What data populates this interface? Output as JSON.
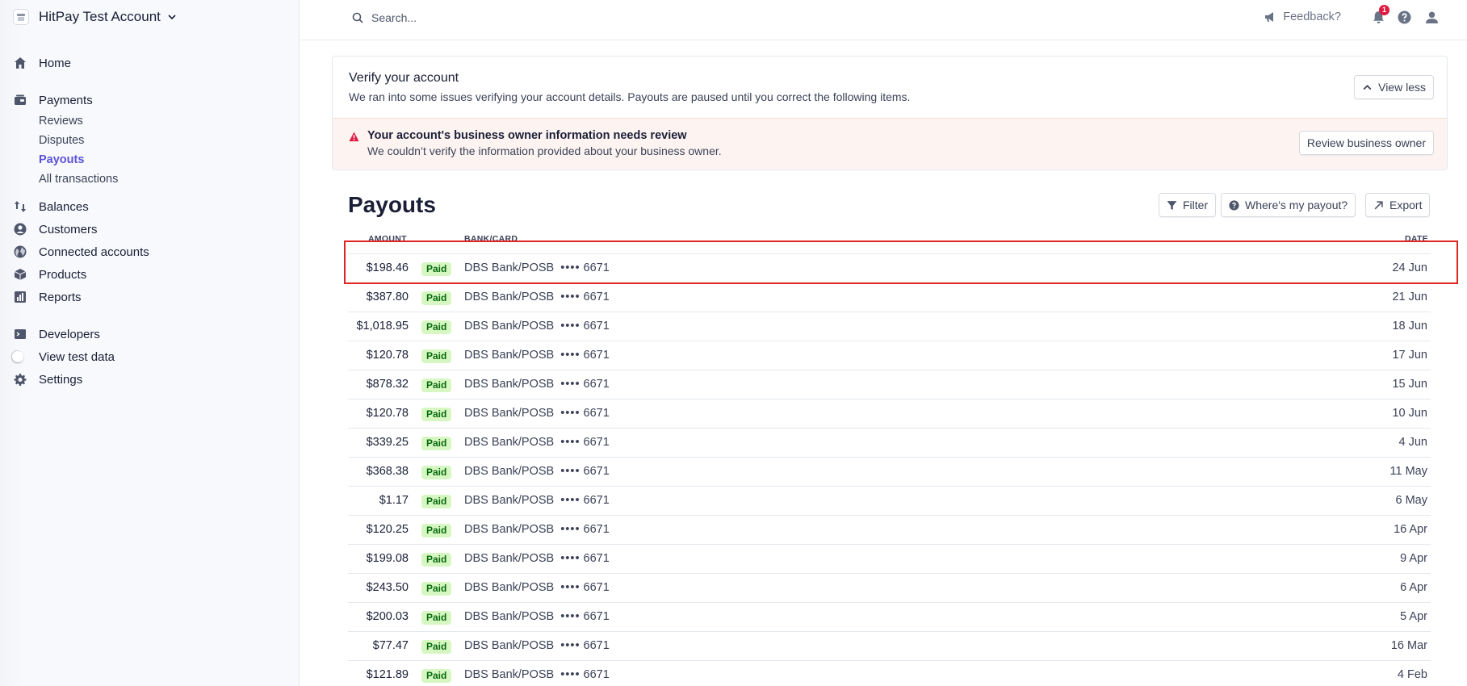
{
  "account": {
    "name": "HitPay Test Account"
  },
  "nav": {
    "home": "Home",
    "payments": "Payments",
    "payments_sub": {
      "reviews": "Reviews",
      "disputes": "Disputes",
      "payouts": "Payouts",
      "all_transactions": "All transactions"
    },
    "balances": "Balances",
    "customers": "Customers",
    "connected_accounts": "Connected accounts",
    "products": "Products",
    "reports": "Reports",
    "developers": "Developers",
    "view_test_data": "View test data",
    "settings": "Settings"
  },
  "topbar": {
    "search_placeholder": "Search...",
    "feedback": "Feedback?",
    "notification_count": "1"
  },
  "verify": {
    "title": "Verify your account",
    "description": "We ran into some issues verifying your account details. Payouts are paused until you correct the following items.",
    "view_less": "View less",
    "alert_title": "Your account's business owner information needs review",
    "alert_description": "We couldn’t verify the information provided about your business owner.",
    "review_button": "Review business owner"
  },
  "payouts": {
    "title": "Payouts",
    "filter": "Filter",
    "wheres_my_payout": "Where's my payout?",
    "export": "Export",
    "columns": {
      "amount": "AMOUNT",
      "bank": "BANK/CARD",
      "date": "DATE"
    },
    "rows": [
      {
        "amount": "$198.46",
        "status": "Paid",
        "bank": "DBS Bank/POSB",
        "dots": "••••",
        "last4": "6671",
        "date": "24 Jun"
      },
      {
        "amount": "$387.80",
        "status": "Paid",
        "bank": "DBS Bank/POSB",
        "dots": "••••",
        "last4": "6671",
        "date": "21 Jun"
      },
      {
        "amount": "$1,018.95",
        "status": "Paid",
        "bank": "DBS Bank/POSB",
        "dots": "••••",
        "last4": "6671",
        "date": "18 Jun"
      },
      {
        "amount": "$120.78",
        "status": "Paid",
        "bank": "DBS Bank/POSB",
        "dots": "••••",
        "last4": "6671",
        "date": "17 Jun"
      },
      {
        "amount": "$878.32",
        "status": "Paid",
        "bank": "DBS Bank/POSB",
        "dots": "••••",
        "last4": "6671",
        "date": "15 Jun"
      },
      {
        "amount": "$120.78",
        "status": "Paid",
        "bank": "DBS Bank/POSB",
        "dots": "••••",
        "last4": "6671",
        "date": "10 Jun"
      },
      {
        "amount": "$339.25",
        "status": "Paid",
        "bank": "DBS Bank/POSB",
        "dots": "••••",
        "last4": "6671",
        "date": "4 Jun"
      },
      {
        "amount": "$368.38",
        "status": "Paid",
        "bank": "DBS Bank/POSB",
        "dots": "••••",
        "last4": "6671",
        "date": "11 May"
      },
      {
        "amount": "$1.17",
        "status": "Paid",
        "bank": "DBS Bank/POSB",
        "dots": "••••",
        "last4": "6671",
        "date": "6 May"
      },
      {
        "amount": "$120.25",
        "status": "Paid",
        "bank": "DBS Bank/POSB",
        "dots": "••••",
        "last4": "6671",
        "date": "16 Apr"
      },
      {
        "amount": "$199.08",
        "status": "Paid",
        "bank": "DBS Bank/POSB",
        "dots": "••••",
        "last4": "6671",
        "date": "9 Apr"
      },
      {
        "amount": "$243.50",
        "status": "Paid",
        "bank": "DBS Bank/POSB",
        "dots": "••••",
        "last4": "6671",
        "date": "6 Apr"
      },
      {
        "amount": "$200.03",
        "status": "Paid",
        "bank": "DBS Bank/POSB",
        "dots": "••••",
        "last4": "6671",
        "date": "5 Apr"
      },
      {
        "amount": "$77.47",
        "status": "Paid",
        "bank": "DBS Bank/POSB",
        "dots": "••••",
        "last4": "6671",
        "date": "16 Mar"
      },
      {
        "amount": "$121.89",
        "status": "Paid",
        "bank": "DBS Bank/POSB",
        "dots": "••••",
        "last4": "6671",
        "date": "4 Feb"
      }
    ]
  },
  "colors": {
    "accent": "#5b52d6",
    "paid_bg": "#d7f7c2",
    "paid_text": "#05690d",
    "highlight": "#e02424",
    "alert_bg": "#fdf4f2"
  }
}
